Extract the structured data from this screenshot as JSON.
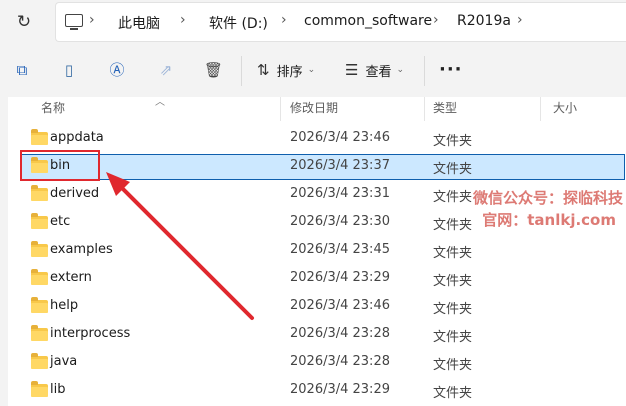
{
  "address_bar": {
    "crumbs": [
      "此电脑",
      "软件 (D:)",
      "common_software",
      "R2019a"
    ]
  },
  "toolbar": {
    "sort_label": "排序",
    "view_label": "查看",
    "more_label": "···"
  },
  "columns": {
    "name": "名称",
    "modified": "修改日期",
    "type": "类型",
    "size": "大小"
  },
  "rows": [
    {
      "name": "appdata",
      "modified": "2026/3/4 23:46",
      "type": "文件夹"
    },
    {
      "name": "bin",
      "modified": "2026/3/4 23:37",
      "type": "文件夹",
      "selected": true
    },
    {
      "name": "derived",
      "modified": "2026/3/4 23:31",
      "type": "文件夹"
    },
    {
      "name": "etc",
      "modified": "2026/3/4 23:30",
      "type": "文件夹"
    },
    {
      "name": "examples",
      "modified": "2026/3/4 23:45",
      "type": "文件夹"
    },
    {
      "name": "extern",
      "modified": "2026/3/4 23:29",
      "type": "文件夹"
    },
    {
      "name": "help",
      "modified": "2026/3/4 23:46",
      "type": "文件夹"
    },
    {
      "name": "interprocess",
      "modified": "2026/3/4 23:28",
      "type": "文件夹"
    },
    {
      "name": "java",
      "modified": "2026/3/4 23:28",
      "type": "文件夹"
    },
    {
      "name": "lib",
      "modified": "2026/3/4 23:29",
      "type": "文件夹"
    }
  ],
  "watermark": {
    "line1": "微信公众号：探临科技",
    "line2": "官网：tanlkj.com"
  },
  "colors": {
    "selection_bg": "#cce8ff",
    "selection_border": "#0f5fad",
    "annotation": "#e0282e",
    "folder": "#ffd865"
  },
  "icons": [
    "refresh-icon",
    "computer-icon",
    "copy-icon",
    "paste-icon",
    "rename-icon",
    "share-icon",
    "delete-icon",
    "sort-icon",
    "view-icon",
    "folder-icon"
  ]
}
